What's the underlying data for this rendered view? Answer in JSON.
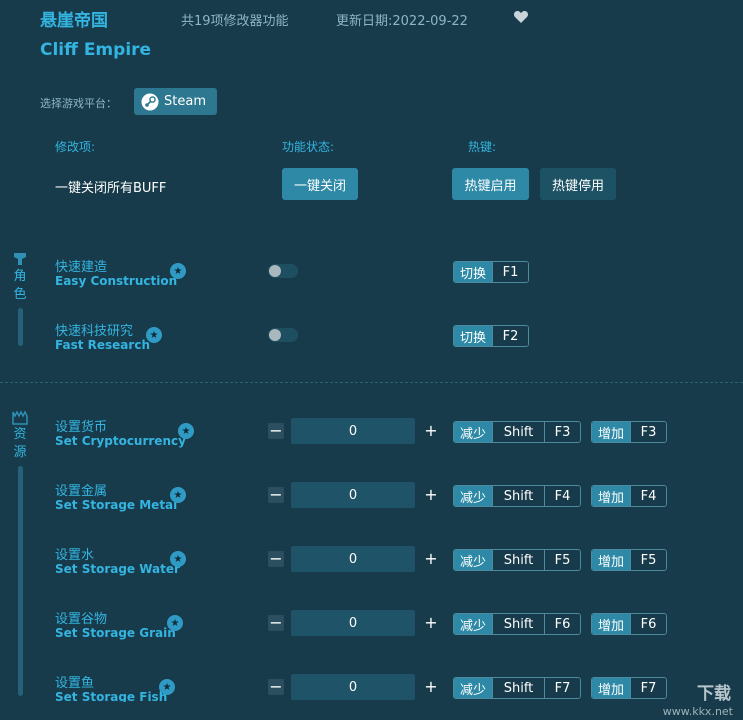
{
  "header": {
    "title_cn": "悬崖帝国",
    "feature_count": "共19项修改器功能",
    "update_date": "更新日期:2022-09-22",
    "title_en": "Cliff Empire"
  },
  "platform": {
    "label": "选择游戏平台：",
    "button": "Steam"
  },
  "columns": {
    "mod": "修改项:",
    "status": "功能状态:",
    "hotkey": "热键:"
  },
  "global": {
    "label": "一键关闭所有BUFF",
    "close_all": "一键关闭",
    "hotkey_on": "热键启用",
    "hotkey_off": "热键停用"
  },
  "categories": {
    "character": [
      "角",
      "色"
    ],
    "resources": [
      "资",
      "源"
    ]
  },
  "toggles": [
    {
      "name_cn": "快速建造",
      "name_en": "Easy Construction",
      "on": false,
      "key_label": "切换",
      "key": "F1"
    },
    {
      "name_cn": "快速科技研究",
      "name_en": "Fast Research",
      "on": false,
      "key_label": "切换",
      "key": "F2"
    }
  ],
  "setters": [
    {
      "name_cn": "设置货币",
      "name_en": "Set Cryptocurrency",
      "value": "0",
      "dec_label": "减少",
      "dec_mod": "Shift",
      "dec_key": "F3",
      "inc_label": "增加",
      "inc_key": "F3"
    },
    {
      "name_cn": "设置金属",
      "name_en": "Set Storage Metal",
      "value": "0",
      "dec_label": "减少",
      "dec_mod": "Shift",
      "dec_key": "F4",
      "inc_label": "增加",
      "inc_key": "F4"
    },
    {
      "name_cn": "设置水",
      "name_en": "Set Storage Water",
      "value": "0",
      "dec_label": "减少",
      "dec_mod": "Shift",
      "dec_key": "F5",
      "inc_label": "增加",
      "inc_key": "F5"
    },
    {
      "name_cn": "设置谷物",
      "name_en": "Set Storage Grain",
      "value": "0",
      "dec_label": "减少",
      "dec_mod": "Shift",
      "dec_key": "F6",
      "inc_label": "增加",
      "inc_key": "F6"
    },
    {
      "name_cn": "设置鱼",
      "name_en": "Set Storage Fish",
      "value": "0",
      "dec_label": "减少",
      "dec_mod": "Shift",
      "dec_key": "F7",
      "inc_label": "增加",
      "inc_key": "F7"
    }
  ],
  "symbols": {
    "minus": "−",
    "plus": "+",
    "star": "★"
  },
  "watermark": {
    "logo": "下载",
    "url": "www.kkx.net"
  },
  "icons": {
    "favorite": "heart-icon",
    "steam": "steam-icon",
    "character": "character-icon",
    "resources": "resources-icon",
    "star": "star-icon"
  },
  "colors": {
    "background": "#173b4a",
    "accent": "#34b4e0",
    "button": "#2d89a6"
  }
}
